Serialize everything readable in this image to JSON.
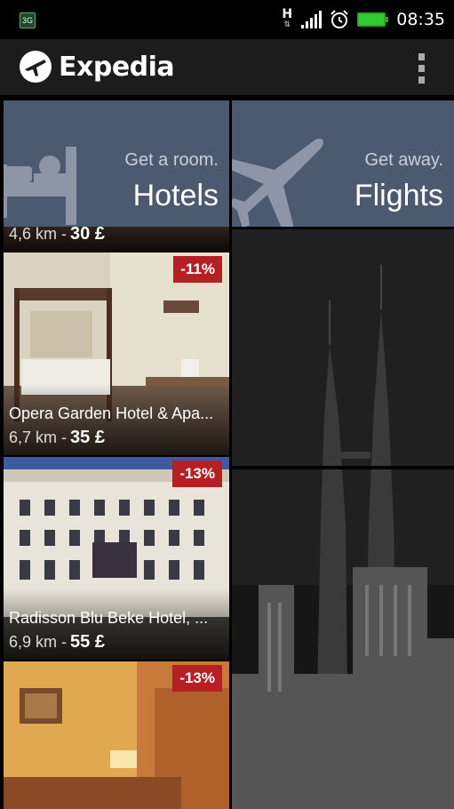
{
  "status_bar": {
    "network_badge": "3G",
    "data_indicator": "H",
    "time": "08:35"
  },
  "app_bar": {
    "brand": "Expedia",
    "logo_icon": "plane-globe-icon",
    "overflow_icon": "overflow-menu-icon"
  },
  "categories": [
    {
      "subtitle": "Get a room.",
      "title": "Hotels",
      "icon": "bed-icon"
    },
    {
      "subtitle": "Get away.",
      "title": "Flights",
      "icon": "airplane-icon"
    }
  ],
  "hotels": [
    {
      "name": "",
      "distance": "4,6 km -",
      "price": "30 £",
      "discount": ""
    },
    {
      "name": "Opera Garden Hotel & Apa...",
      "distance": "6,7 km -",
      "price": "35 £",
      "discount": "-11%"
    },
    {
      "name": "Radisson Blu Beke Hotel, ...",
      "distance": "6,9 km -",
      "price": "55 £",
      "discount": "-13%"
    },
    {
      "name": "",
      "distance": "",
      "price": "",
      "discount": "-13%"
    }
  ],
  "colors": {
    "tile_bg": "#4c5a70",
    "badge_red": "#b52025",
    "battery_green": "#3c3"
  }
}
